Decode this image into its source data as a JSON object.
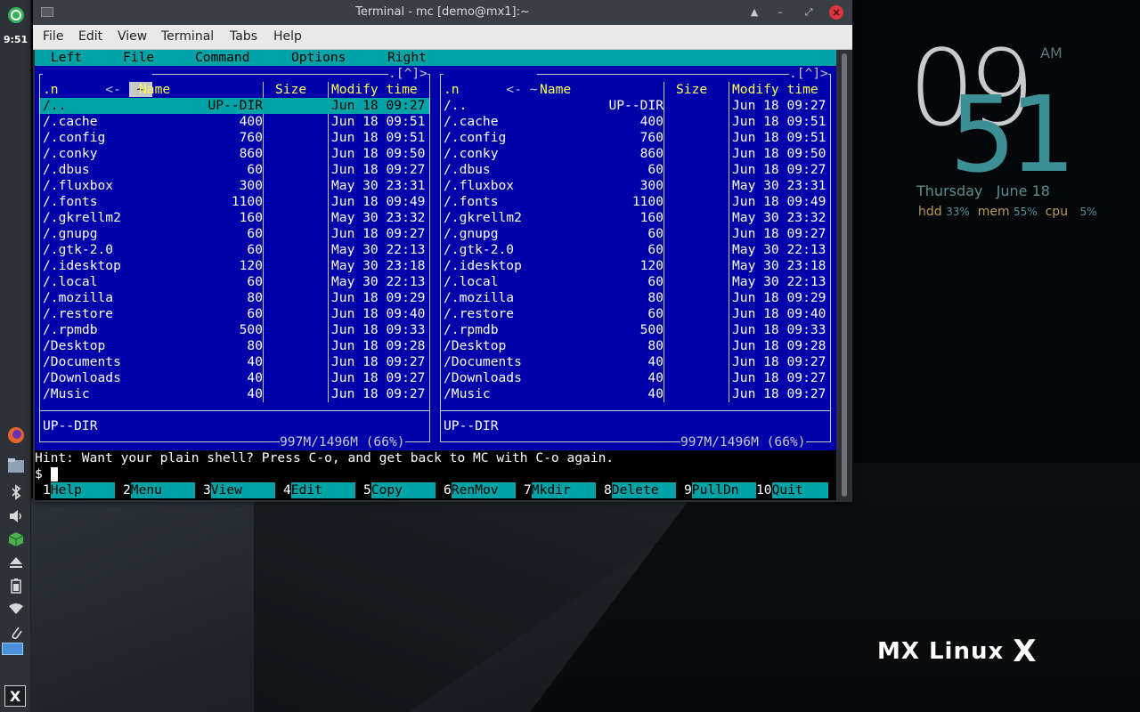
{
  "panel": {
    "clock": "9:51",
    "items": [
      "mx-logo-icon",
      "firefox-icon",
      "files-icon",
      "bluetooth-icon",
      "volume-icon",
      "package-icon",
      "eject-icon",
      "battery-icon",
      "wifi-icon",
      "clip-icon"
    ]
  },
  "window": {
    "title": "Terminal - mc [demo@mx1]:~",
    "menu": [
      "File",
      "Edit",
      "View",
      "Terminal",
      "Tabs",
      "Help"
    ]
  },
  "mc": {
    "menu": [
      "Left",
      "File",
      "Command",
      "Options",
      "Right"
    ],
    "left_path": "~",
    "right_path": "~",
    "left_topbar_prefix": "<-",
    "left_topbar_suffix": ".[^]>",
    "right_topbar_prefix": "<-",
    "right_topbar_suffix": ".[^]>",
    "headers": {
      "n": ".n",
      "name": "Name",
      "size": "Size",
      "mtime": "Modify time"
    },
    "files": [
      {
        "name": "/..",
        "size": "UP--DIR",
        "mtime": "Jun 18 09:27"
      },
      {
        "name": "/.cache",
        "size": "400",
        "mtime": "Jun 18 09:51"
      },
      {
        "name": "/.config",
        "size": "760",
        "mtime": "Jun 18 09:51"
      },
      {
        "name": "/.conky",
        "size": "860",
        "mtime": "Jun 18 09:50"
      },
      {
        "name": "/.dbus",
        "size": "60",
        "mtime": "Jun 18 09:27"
      },
      {
        "name": "/.fluxbox",
        "size": "300",
        "mtime": "May 30 23:31"
      },
      {
        "name": "/.fonts",
        "size": "1100",
        "mtime": "Jun 18 09:49"
      },
      {
        "name": "/.gkrellm2",
        "size": "160",
        "mtime": "May 30 23:32"
      },
      {
        "name": "/.gnupg",
        "size": "60",
        "mtime": "Jun 18 09:27"
      },
      {
        "name": "/.gtk-2.0",
        "size": "60",
        "mtime": "May 30 22:13"
      },
      {
        "name": "/.idesktop",
        "size": "120",
        "mtime": "May 30 23:18"
      },
      {
        "name": "/.local",
        "size": "60",
        "mtime": "May 30 22:13"
      },
      {
        "name": "/.mozilla",
        "size": "80",
        "mtime": "Jun 18 09:29"
      },
      {
        "name": "/.restore",
        "size": "60",
        "mtime": "Jun 18 09:40"
      },
      {
        "name": "/.rpmdb",
        "size": "500",
        "mtime": "Jun 18 09:33"
      },
      {
        "name": "/Desktop",
        "size": "80",
        "mtime": "Jun 18 09:28"
      },
      {
        "name": "/Documents",
        "size": "40",
        "mtime": "Jun 18 09:27"
      },
      {
        "name": "/Downloads",
        "size": "40",
        "mtime": "Jun 18 09:27"
      },
      {
        "name": "/Music",
        "size": "40",
        "mtime": "Jun 18 09:27"
      }
    ],
    "status": "UP--DIR",
    "disk": "997M/1496M (66%)",
    "hint": "Hint: Want your plain shell? Press C-o, and get back to MC with C-o again.",
    "prompt": "$ ",
    "fkeys": [
      {
        "num": "1",
        "label": "Help"
      },
      {
        "num": "2",
        "label": "Menu"
      },
      {
        "num": "3",
        "label": "View"
      },
      {
        "num": "4",
        "label": "Edit"
      },
      {
        "num": "5",
        "label": "Copy"
      },
      {
        "num": "6",
        "label": "RenMov"
      },
      {
        "num": "7",
        "label": "Mkdir"
      },
      {
        "num": "8",
        "label": "Delete"
      },
      {
        "num": "9",
        "label": "PullDn"
      },
      {
        "num": "10",
        "label": "Quit"
      }
    ]
  },
  "conky": {
    "hour": "09",
    "minute": "51",
    "ampm": "AM",
    "day": "Thursday",
    "date": "June 18",
    "hdd_label": "hdd",
    "hdd": "33%",
    "mem_label": "mem",
    "mem": "55%",
    "cpu_label": "cpu",
    "cpu": "5%"
  },
  "logo": {
    "text": "MX Linux",
    "mark": "X"
  },
  "colors": {
    "mc_blue": "#0000aa",
    "mc_cyan": "#00a4a6",
    "header_yellow": "#ffff55",
    "conky_teal": "#3b8f95"
  }
}
